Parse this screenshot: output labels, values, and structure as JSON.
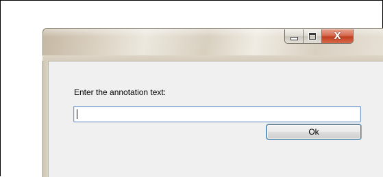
{
  "dialog": {
    "caption_buttons": {
      "minimize_icon": "minimize-icon",
      "maximize_icon": "maximize-icon",
      "close_icon": "close-icon",
      "close_glyph": "X"
    },
    "prompt_label": "Enter the annotation text:",
    "input": {
      "value": "",
      "placeholder": ""
    },
    "ok_label": "Ok"
  },
  "colors": {
    "client_background": "#f0f0f0",
    "close_button": "#c0401f",
    "input_border": "#7a9ccc",
    "focus_ring": "#6fb6e6"
  }
}
